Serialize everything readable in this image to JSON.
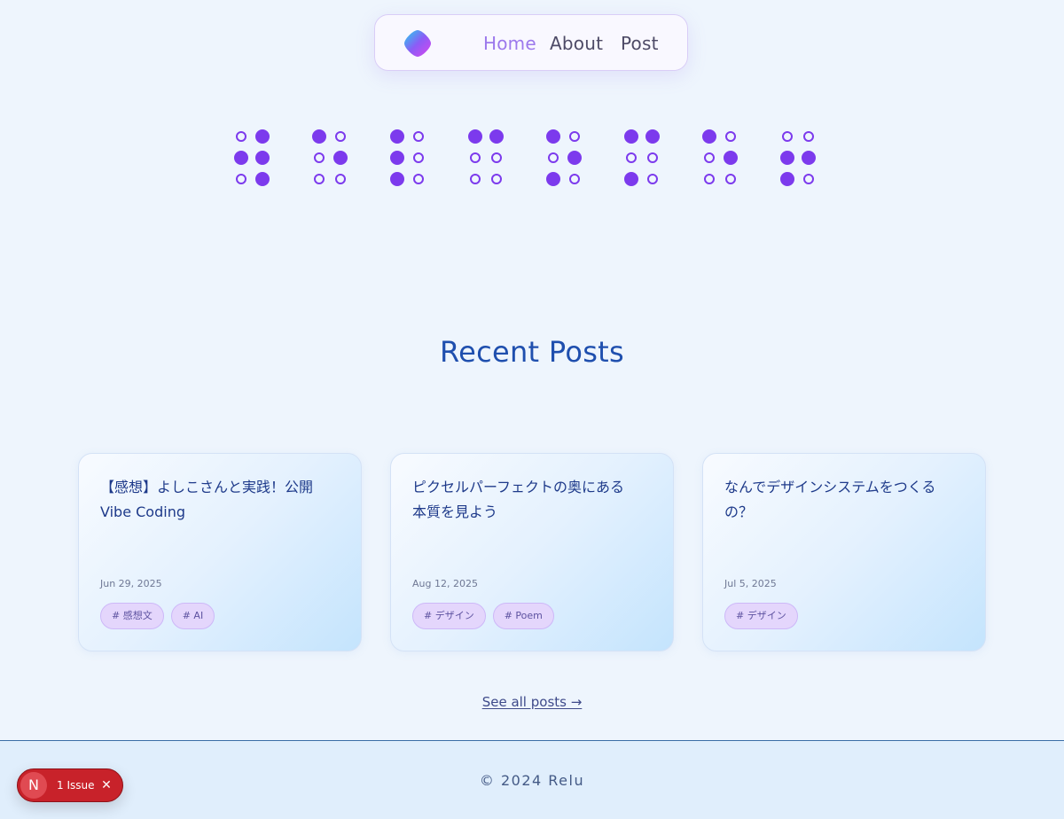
{
  "nav": {
    "logo_icon": "gradient-blob-logo",
    "links": [
      {
        "label": "Home",
        "active": true
      },
      {
        "label": "About",
        "active": false
      },
      {
        "label": "Post",
        "active": false
      }
    ]
  },
  "braille": {
    "color": "#7c3aed",
    "cells": [
      [
        0,
        1,
        1,
        1,
        0,
        1
      ],
      [
        1,
        0,
        0,
        1,
        0,
        0
      ],
      [
        1,
        0,
        1,
        0,
        1,
        0
      ],
      [
        1,
        1,
        0,
        0,
        0,
        0
      ],
      [
        1,
        0,
        0,
        1,
        1,
        0
      ],
      [
        1,
        1,
        0,
        0,
        1,
        0
      ],
      [
        1,
        0,
        0,
        1,
        0,
        0
      ],
      [
        0,
        0,
        1,
        1,
        1,
        0
      ]
    ]
  },
  "recent_posts": {
    "heading": "Recent Posts",
    "posts": [
      {
        "title": "【感想】よしこさんと実践！公開Vibe Coding",
        "date": "Jun 29, 2025",
        "tags": [
          "# 感想文",
          "# AI"
        ]
      },
      {
        "title": "ピクセルパーフェクトの奥にある本質を見よう",
        "date": "Aug 12, 2025",
        "tags": [
          "# デザイン",
          "# Poem"
        ]
      },
      {
        "title": "なんでデザインシステムをつくるの？",
        "date": "Jul 5, 2025",
        "tags": [
          "# デザイン"
        ]
      }
    ],
    "see_all": "See all posts →"
  },
  "footer": {
    "copyright": "© 2024 Relu"
  },
  "issue_badge": {
    "letter": "N",
    "text": "1 Issue",
    "close_icon": "close-icon",
    "color": "#c8222a"
  },
  "colors": {
    "accent": "#7c3aed",
    "heading": "#1f4fae",
    "background": "#eef5fd"
  }
}
